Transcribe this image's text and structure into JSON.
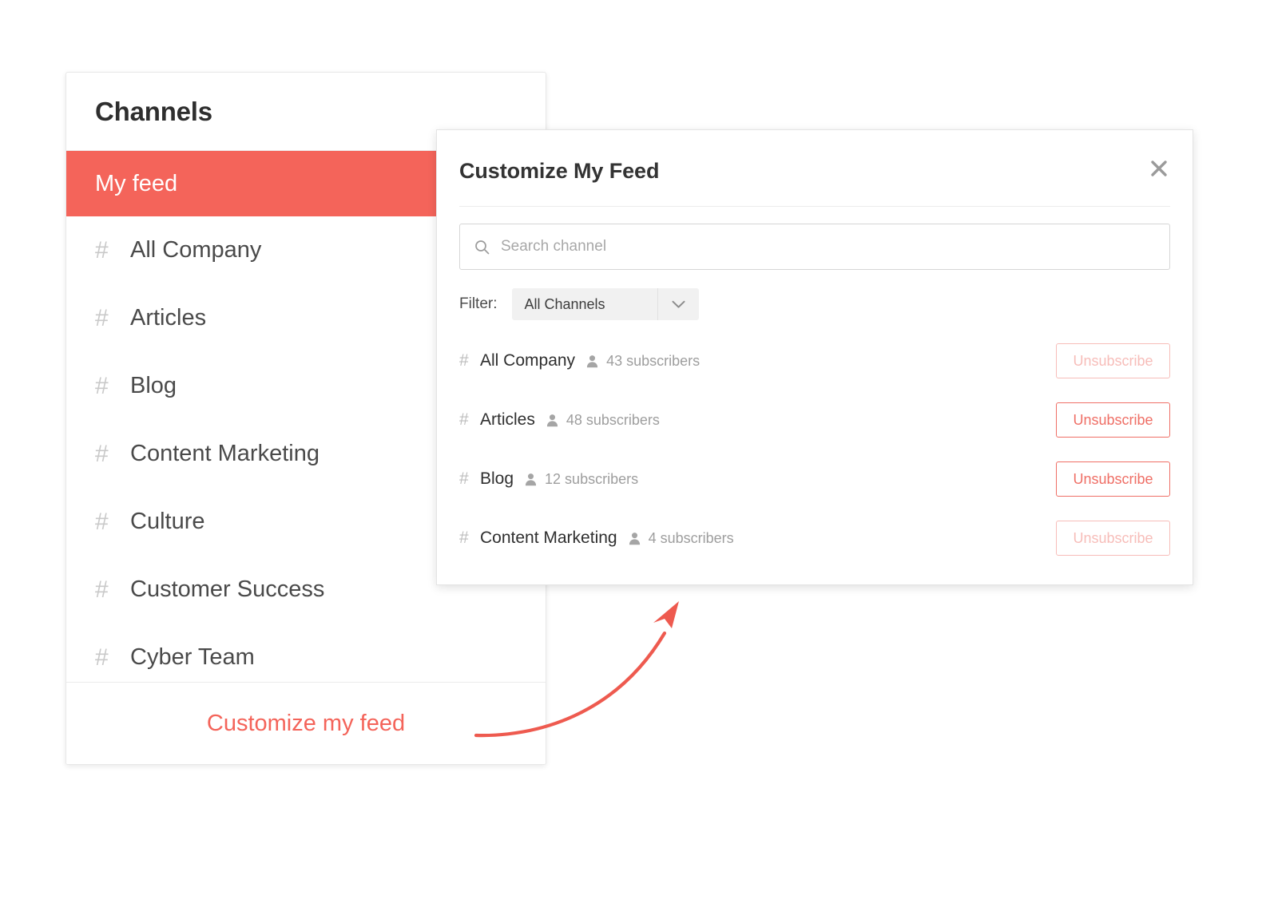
{
  "theme": {
    "accent": "#F4645A",
    "accent_button_border": "#EF6F66",
    "text_primary": "#2E2E2E",
    "text_muted": "#9E9E9E",
    "panel_bg": "#FFFFFF",
    "page_bg": "#FFFFFF"
  },
  "sidebar": {
    "title": "Channels",
    "items": [
      {
        "label": "My feed",
        "hash": "",
        "active": true
      },
      {
        "label": "All Company",
        "hash": "#",
        "active": false
      },
      {
        "label": "Articles",
        "hash": "#",
        "active": false
      },
      {
        "label": "Blog",
        "hash": "#",
        "active": false
      },
      {
        "label": "Content Marketing",
        "hash": "#",
        "active": false
      },
      {
        "label": "Culture",
        "hash": "#",
        "active": false
      },
      {
        "label": "Customer Success",
        "hash": "#",
        "active": false
      },
      {
        "label": "Cyber Team",
        "hash": "#",
        "active": false
      }
    ],
    "footer_link": "Customize my feed"
  },
  "modal": {
    "title": "Customize My Feed",
    "close_icon": "close-icon",
    "search": {
      "icon": "search-icon",
      "value": "",
      "placeholder": "Search channel"
    },
    "filter": {
      "label": "Filter:",
      "selected": "All Channels",
      "chevron_icon": "chevron-down-icon"
    },
    "channels": [
      {
        "hash": "#",
        "name": "All Company",
        "subscribers": "43 subscribers",
        "action": "Unsubscribe",
        "faded": true
      },
      {
        "hash": "#",
        "name": "Articles",
        "subscribers": "48 subscribers",
        "action": "Unsubscribe",
        "faded": false
      },
      {
        "hash": "#",
        "name": "Blog",
        "subscribers": "12 subscribers",
        "action": "Unsubscribe",
        "faded": false
      },
      {
        "hash": "#",
        "name": "Content Marketing",
        "subscribers": "4 subscribers",
        "action": "Unsubscribe",
        "faded": true
      }
    ]
  },
  "annotation": {
    "name": "curved-arrow",
    "color": "#EE5A4F"
  }
}
